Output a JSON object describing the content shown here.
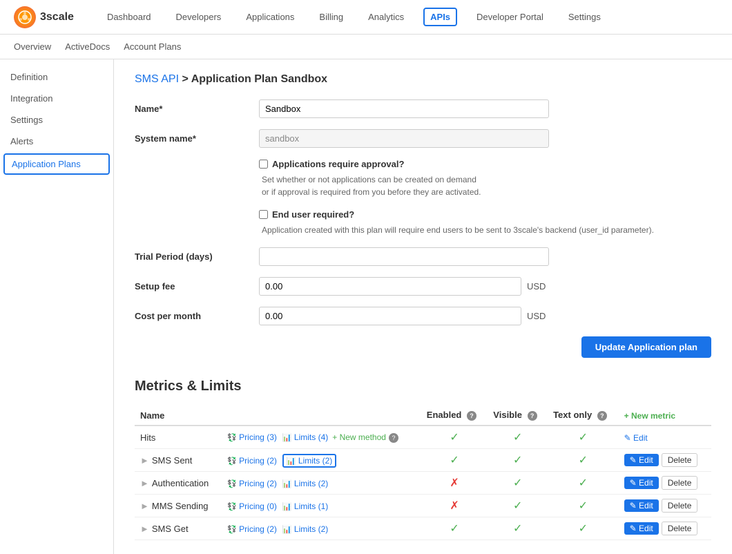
{
  "logo": {
    "text": "3scale"
  },
  "nav": {
    "items": [
      {
        "label": "Dashboard",
        "active": false
      },
      {
        "label": "Developers",
        "active": false
      },
      {
        "label": "Applications",
        "active": false
      },
      {
        "label": "Billing",
        "active": false
      },
      {
        "label": "Analytics",
        "active": false
      },
      {
        "label": "APIs",
        "active": true
      },
      {
        "label": "Developer Portal",
        "active": false
      },
      {
        "label": "Settings",
        "active": false
      }
    ]
  },
  "subnav": {
    "items": [
      {
        "label": "Overview"
      },
      {
        "label": "ActiveDocs"
      },
      {
        "label": "Account Plans"
      }
    ]
  },
  "sidebar": {
    "items": [
      {
        "label": "Definition",
        "active": false
      },
      {
        "label": "Integration",
        "active": false
      },
      {
        "label": "Settings",
        "active": false
      },
      {
        "label": "Alerts",
        "active": false
      },
      {
        "label": "Application Plans",
        "active": true
      }
    ]
  },
  "breadcrumb": {
    "api_link": "SMS API",
    "separator": " > ",
    "current": "Application Plan Sandbox"
  },
  "form": {
    "name_label": "Name*",
    "name_value": "Sandbox",
    "system_name_label": "System name*",
    "system_name_value": "sandbox",
    "approval_label": "Applications require approval?",
    "approval_desc1": "Set whether or not applications can be created on demand",
    "approval_desc2": "or if approval is required from you before they are activated.",
    "enduser_label": "End user required?",
    "enduser_desc": "Application created with this plan will require end users to be sent to 3scale's backend (user_id parameter).",
    "trial_period_label": "Trial Period (days)",
    "trial_period_value": "",
    "setup_fee_label": "Setup fee",
    "setup_fee_value": "0.00",
    "cost_per_month_label": "Cost per month",
    "cost_per_month_value": "0.00",
    "usd_label": "USD",
    "update_button": "Update Application plan"
  },
  "metrics": {
    "title": "Metrics & Limits",
    "columns": {
      "name": "Name",
      "enabled": "Enabled",
      "visible": "Visible",
      "text_only": "Text only",
      "new_metric": "+ New metric"
    },
    "rows": [
      {
        "name": "Hits",
        "indent": false,
        "pricing": "Pricing (3)",
        "limits": "Limits (4)",
        "new_method": "+ New method",
        "enabled": true,
        "visible": true,
        "text_only": true,
        "show_edit_blue": true,
        "limits_highlighted": false
      },
      {
        "name": "SMS Sent",
        "indent": true,
        "pricing": "Pricing (2)",
        "limits": "Limits (2)",
        "new_method": null,
        "enabled": true,
        "visible": true,
        "text_only": true,
        "show_edit_blue": false,
        "limits_highlighted": true
      },
      {
        "name": "Authentication",
        "indent": true,
        "pricing": "Pricing (2)",
        "limits": "Limits (2)",
        "new_method": null,
        "enabled": false,
        "visible": true,
        "text_only": true,
        "show_edit_blue": false,
        "limits_highlighted": false
      },
      {
        "name": "MMS Sending",
        "indent": true,
        "pricing": "Pricing (0)",
        "limits": "Limits (1)",
        "new_method": null,
        "enabled": false,
        "visible": true,
        "text_only": true,
        "show_edit_blue": false,
        "limits_highlighted": false
      },
      {
        "name": "SMS Get",
        "indent": true,
        "pricing": "Pricing (2)",
        "limits": "Limits (2)",
        "new_method": null,
        "enabled": true,
        "visible": true,
        "text_only": true,
        "show_edit_blue": false,
        "limits_highlighted": false
      }
    ]
  }
}
